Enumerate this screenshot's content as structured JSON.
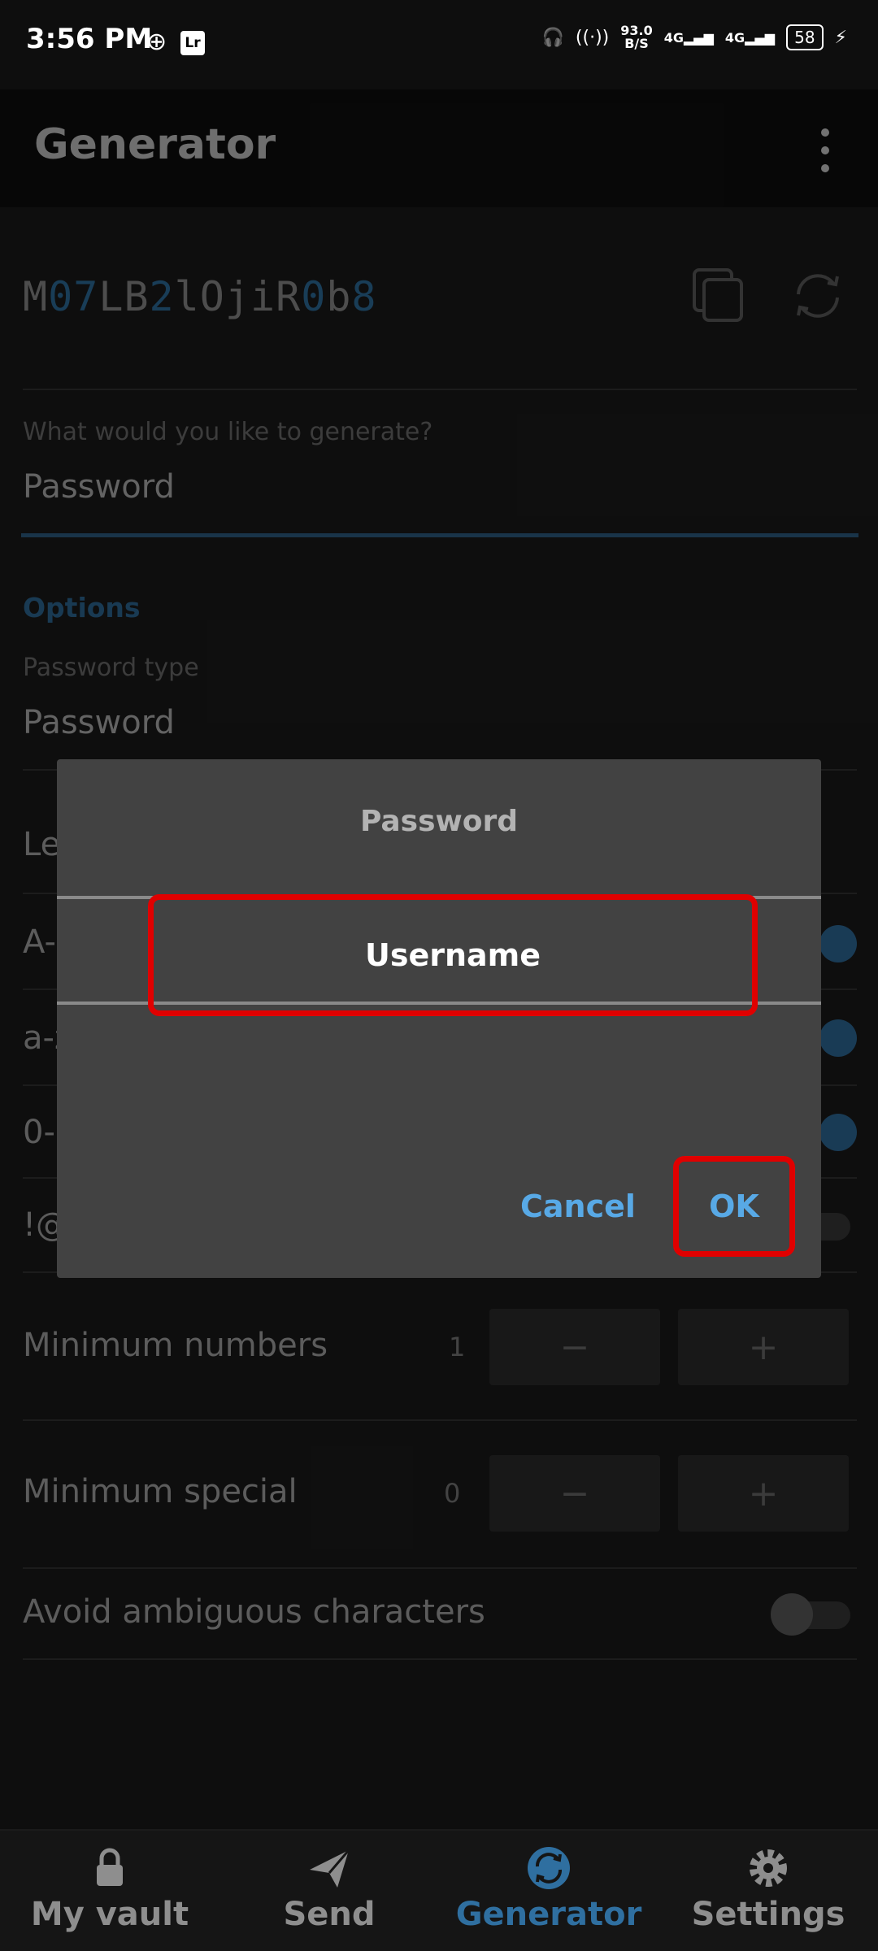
{
  "status_bar": {
    "time": "3:56 PM",
    "lr_badge": "Lr",
    "net_speed_value": "93.0",
    "net_speed_unit": "B/S",
    "sim1": "4G",
    "sim2": "4G",
    "battery": "58"
  },
  "header": {
    "title": "Generator"
  },
  "generator": {
    "password_chars": [
      {
        "c": "M",
        "digit": false
      },
      {
        "c": "0",
        "digit": true
      },
      {
        "c": "7",
        "digit": true
      },
      {
        "c": "L",
        "digit": false
      },
      {
        "c": "B",
        "digit": false
      },
      {
        "c": "2",
        "digit": true
      },
      {
        "c": "l",
        "digit": false
      },
      {
        "c": "O",
        "digit": false
      },
      {
        "c": "j",
        "digit": false
      },
      {
        "c": "i",
        "digit": false
      },
      {
        "c": "R",
        "digit": false
      },
      {
        "c": "0",
        "digit": true
      },
      {
        "c": "b",
        "digit": false
      },
      {
        "c": "8",
        "digit": true
      }
    ],
    "generate_label": "What would you like to generate?",
    "generate_value": "Password",
    "options_title": "Options",
    "password_type_label": "Password type",
    "password_type_value": "Password",
    "rows": {
      "length_prefix": "Le",
      "uppercase_prefix": "A-",
      "lowercase_prefix": "a-z",
      "numbers_prefix": "0-",
      "special_prefix": "!@"
    },
    "min_numbers_label": "Minimum numbers",
    "min_numbers_value": "1",
    "min_special_label": "Minimum special",
    "min_special_value": "0",
    "avoid_ambiguous_label": "Avoid ambiguous characters",
    "minus": "−",
    "plus": "+"
  },
  "dialog": {
    "title": "Password",
    "option": "Username",
    "cancel": "Cancel",
    "ok": "OK"
  },
  "bottom_nav": [
    {
      "label": "My vault",
      "icon": "lock-icon",
      "active": false
    },
    {
      "label": "Send",
      "icon": "send-icon",
      "active": false
    },
    {
      "label": "Generator",
      "icon": "generator-icon",
      "active": true
    },
    {
      "label": "Settings",
      "icon": "gear-icon",
      "active": false
    }
  ],
  "colors": {
    "accent": "#2f6fa0",
    "highlight": "#e00000",
    "dialog_button": "#58a9e6"
  }
}
